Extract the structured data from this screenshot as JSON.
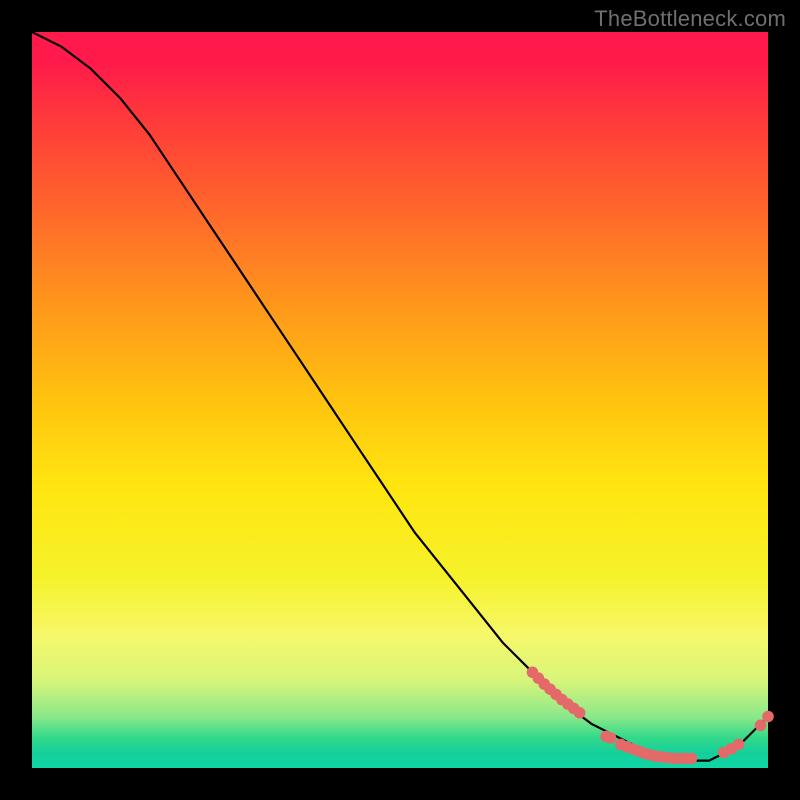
{
  "watermark": "TheBottleneck.com",
  "colors": {
    "marker": "#e46a6a",
    "curve": "#000000",
    "background": "#000000"
  },
  "chart_data": {
    "type": "line",
    "title": "",
    "xlabel": "",
    "ylabel": "",
    "xlim": [
      0,
      100
    ],
    "ylim": [
      0,
      100
    ],
    "grid": false,
    "legend": false,
    "series": [
      {
        "name": "curve",
        "x": [
          0,
          4,
          8,
          12,
          16,
          20,
          24,
          28,
          32,
          36,
          40,
          44,
          48,
          52,
          56,
          60,
          64,
          68,
          72,
          76,
          80,
          84,
          88,
          92,
          96,
          100
        ],
        "y": [
          100,
          98,
          95,
          91,
          86,
          80,
          74,
          68,
          62,
          56,
          50,
          44,
          38,
          32,
          27,
          22,
          17,
          13,
          9,
          6,
          4,
          2,
          1,
          1,
          3,
          7
        ]
      }
    ],
    "marker_clusters": [
      {
        "name": "upper-cluster",
        "points": [
          {
            "x": 68.0,
            "y": 13.0
          },
          {
            "x": 68.8,
            "y": 12.2
          },
          {
            "x": 69.6,
            "y": 11.4
          },
          {
            "x": 70.4,
            "y": 10.7
          },
          {
            "x": 71.2,
            "y": 10.0
          },
          {
            "x": 72.0,
            "y": 9.3
          },
          {
            "x": 72.8,
            "y": 8.7
          },
          {
            "x": 73.6,
            "y": 8.1
          },
          {
            "x": 74.4,
            "y": 7.5
          }
        ]
      },
      {
        "name": "bottom-cluster",
        "points": [
          {
            "x": 78.0,
            "y": 4.3
          },
          {
            "x": 78.6,
            "y": 4.1
          },
          {
            "x": 80.0,
            "y": 3.2
          },
          {
            "x": 80.8,
            "y": 2.9
          },
          {
            "x": 81.6,
            "y": 2.6
          },
          {
            "x": 82.4,
            "y": 2.3
          },
          {
            "x": 83.2,
            "y": 2.0
          },
          {
            "x": 84.0,
            "y": 1.8
          },
          {
            "x": 84.8,
            "y": 1.6
          },
          {
            "x": 85.6,
            "y": 1.5
          },
          {
            "x": 86.4,
            "y": 1.4
          },
          {
            "x": 87.2,
            "y": 1.3
          },
          {
            "x": 88.0,
            "y": 1.3
          },
          {
            "x": 88.8,
            "y": 1.3
          },
          {
            "x": 89.6,
            "y": 1.3
          }
        ]
      },
      {
        "name": "rise-cluster",
        "points": [
          {
            "x": 94.0,
            "y": 2.1
          },
          {
            "x": 95.0,
            "y": 2.6
          },
          {
            "x": 96.0,
            "y": 3.2
          },
          {
            "x": 99.0,
            "y": 5.8
          },
          {
            "x": 100.0,
            "y": 7.0
          }
        ]
      }
    ]
  }
}
